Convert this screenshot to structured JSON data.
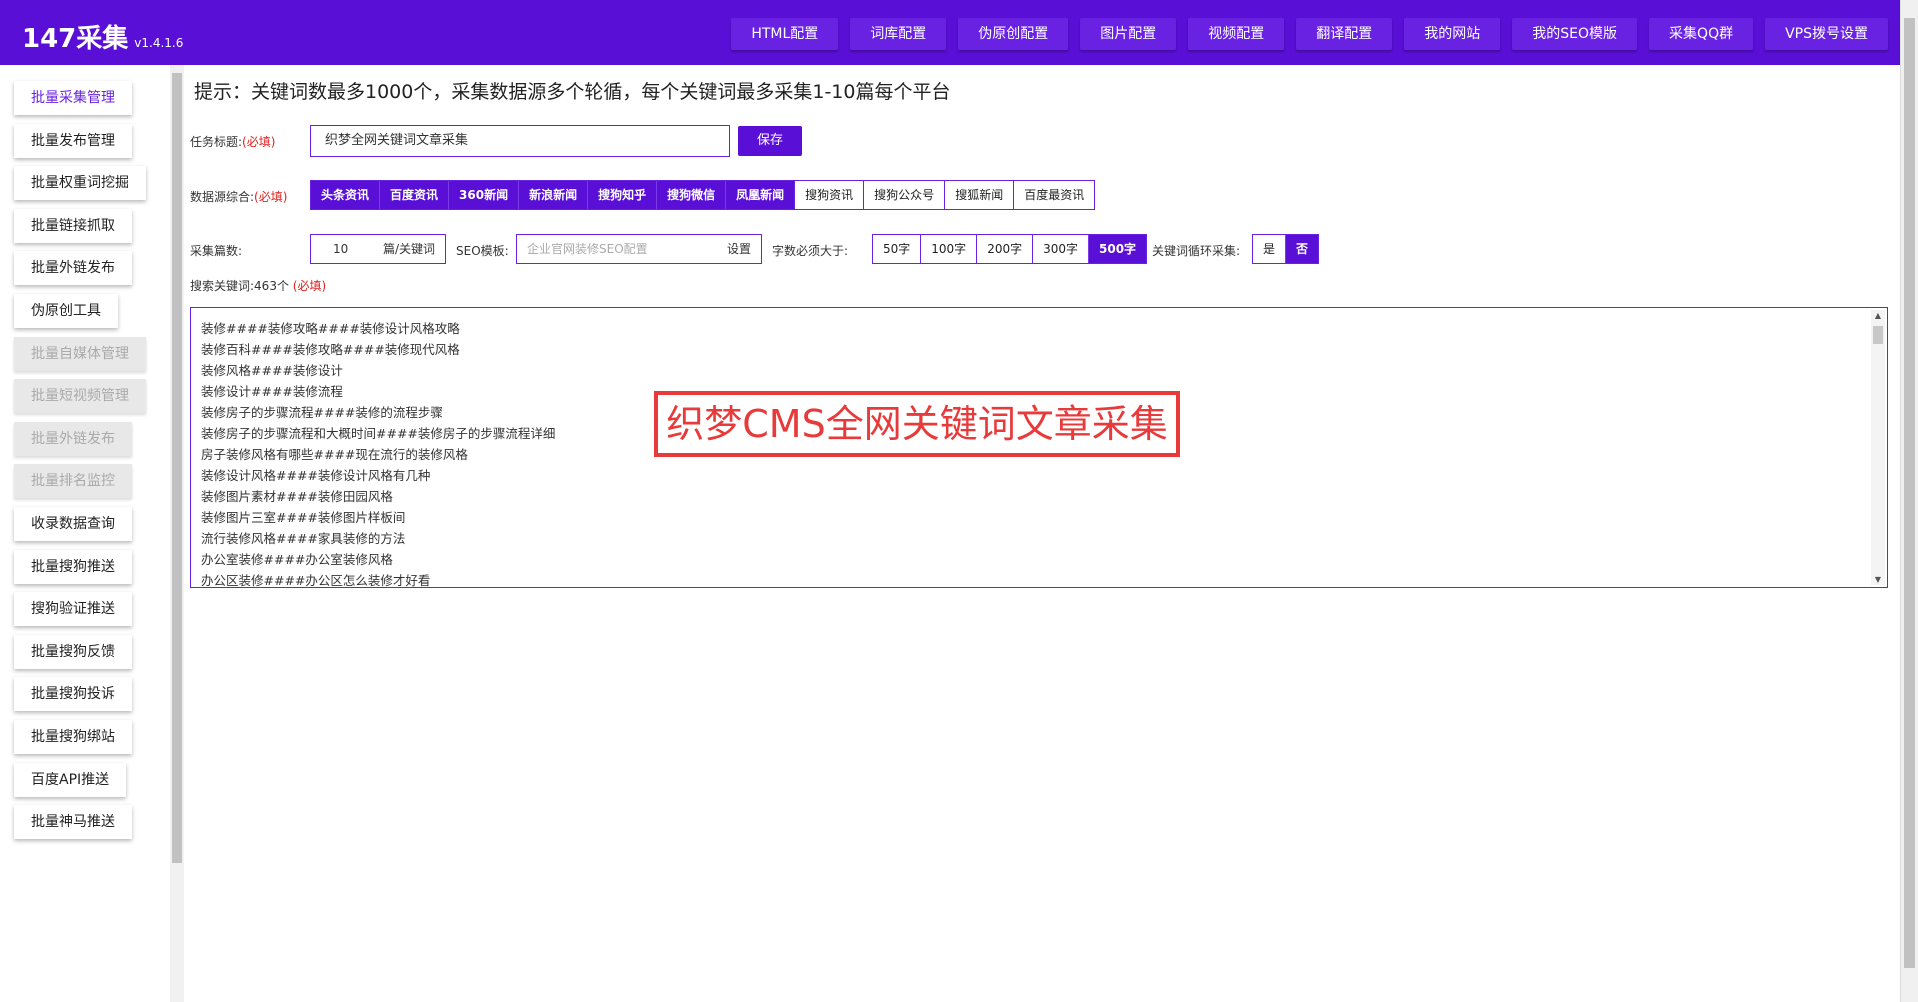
{
  "app": {
    "brand": "147采集",
    "version": "v1.4.1.6"
  },
  "nav": [
    "HTML配置",
    "词库配置",
    "伪原创配置",
    "图片配置",
    "视频配置",
    "翻译配置",
    "我的网站",
    "我的SEO模版",
    "采集QQ群",
    "VPS拨号设置"
  ],
  "sidebar": [
    {
      "label": "批量采集管理",
      "state": "active"
    },
    {
      "label": "批量发布管理",
      "state": "normal"
    },
    {
      "label": "批量权重词挖掘",
      "state": "normal"
    },
    {
      "label": "批量链接抓取",
      "state": "normal"
    },
    {
      "label": "批量外链发布",
      "state": "normal"
    },
    {
      "label": "伪原创工具",
      "state": "normal"
    },
    {
      "label": "批量自媒体管理",
      "state": "disabled"
    },
    {
      "label": "批量短视频管理",
      "state": "disabled"
    },
    {
      "label": "批量外链发布",
      "state": "disabled"
    },
    {
      "label": "批量排名监控",
      "state": "disabled"
    },
    {
      "label": "收录数据查询",
      "state": "normal"
    },
    {
      "label": "批量搜狗推送",
      "state": "normal"
    },
    {
      "label": "搜狗验证推送",
      "state": "normal"
    },
    {
      "label": "批量搜狗反馈",
      "state": "normal"
    },
    {
      "label": "批量搜狗投诉",
      "state": "normal"
    },
    {
      "label": "批量搜狗绑站",
      "state": "normal"
    },
    {
      "label": "百度API推送",
      "state": "normal"
    },
    {
      "label": "批量神马推送",
      "state": "normal"
    }
  ],
  "tip": "提示：关键词数最多1000个，采集数据源多个轮循，每个关键词最多采集1-10篇每个平台",
  "task": {
    "label": "任务标题:",
    "required": "(必填)",
    "value": "织梦全网关键词文章采集",
    "save": "保存"
  },
  "sources": {
    "label": "数据源综合:",
    "required": "(必填)",
    "items": [
      {
        "label": "头条资讯",
        "on": true
      },
      {
        "label": "百度资讯",
        "on": true
      },
      {
        "label": "360新闻",
        "on": true
      },
      {
        "label": "新浪新闻",
        "on": true
      },
      {
        "label": "搜狗知乎",
        "on": true
      },
      {
        "label": "搜狗微信",
        "on": true
      },
      {
        "label": "凤凰新闻",
        "on": true
      },
      {
        "label": "搜狗资讯",
        "on": false
      },
      {
        "label": "搜狗公众号",
        "on": false
      },
      {
        "label": "搜狐新闻",
        "on": false
      },
      {
        "label": "百度最资讯",
        "on": false
      }
    ]
  },
  "count": {
    "label": "采集篇数:",
    "value": "10",
    "unit": "篇/关键词"
  },
  "seo": {
    "label": "SEO模板:",
    "placeholder": "企业官网装修SEO配置",
    "set": "设置"
  },
  "words": {
    "label": "字数必须大于:",
    "items": [
      {
        "label": "50字",
        "on": false
      },
      {
        "label": "100字",
        "on": false
      },
      {
        "label": "200字",
        "on": false
      },
      {
        "label": "300字",
        "on": false
      },
      {
        "label": "500字",
        "on": true
      }
    ]
  },
  "loop": {
    "label": "关键词循环采集:",
    "items": [
      {
        "label": "是",
        "on": false
      },
      {
        "label": "否",
        "on": true
      }
    ]
  },
  "keywords": {
    "label": "搜索关键词:463个",
    "required": "(必填)",
    "lines": [
      "装修####装修攻略####装修设计风格攻略",
      "装修百科####装修攻略####装修现代风格",
      "装修风格####装修设计",
      "装修设计####装修流程",
      "装修房子的步骤流程####装修的流程步骤",
      "装修房子的步骤流程和大概时间####装修房子的步骤流程详细",
      "房子装修风格有哪些####现在流行的装修风格",
      "装修设计风格####装修设计风格有几种",
      "装修图片素材####装修田园风格",
      "装修图片三室####装修图片样板间",
      "流行装修风格####家具装修的方法",
      "办公室装修####办公室装修风格",
      "办公区装修####办公区怎么装修才好看"
    ]
  },
  "watermark": "织梦CMS全网关键词文章采集"
}
